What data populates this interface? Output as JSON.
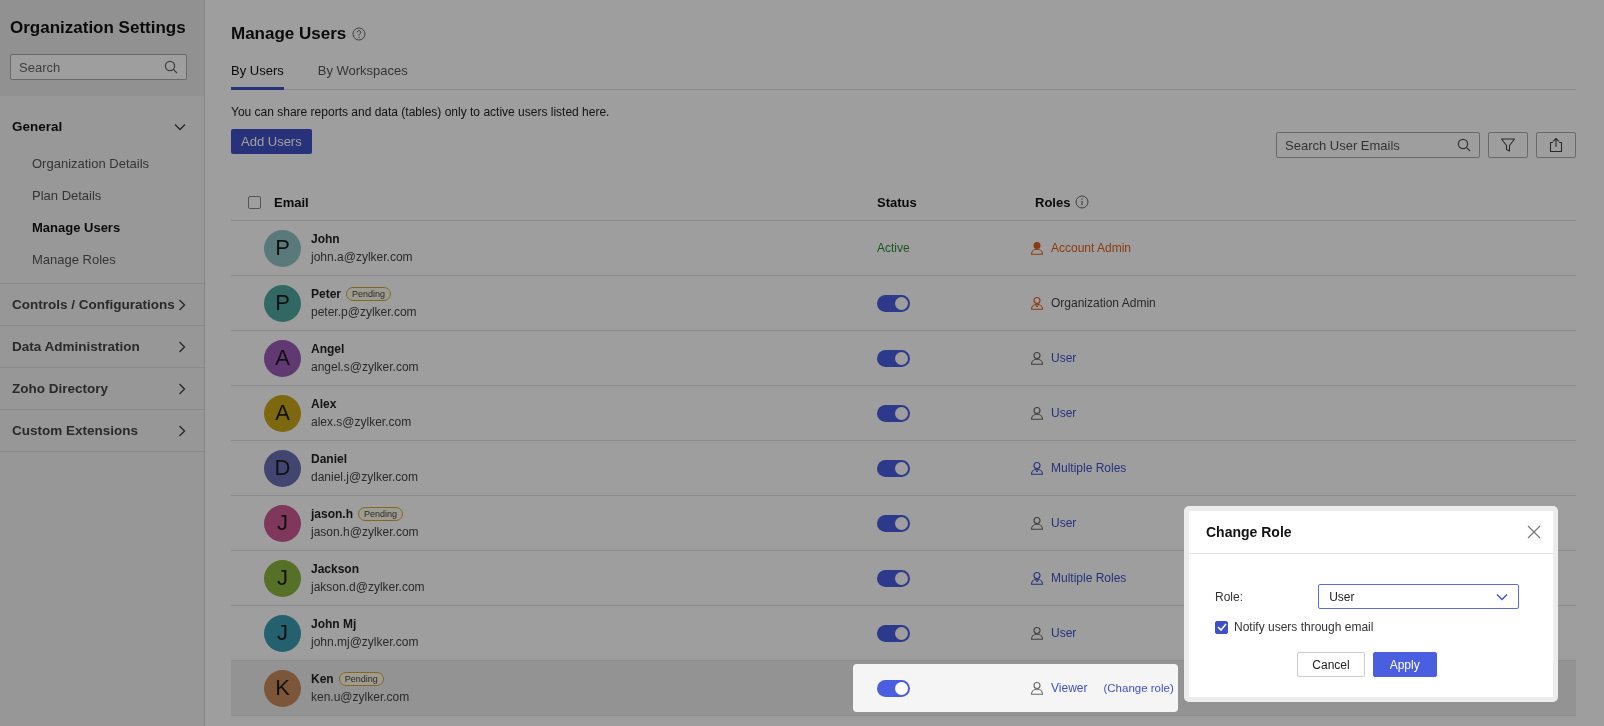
{
  "sidebar": {
    "title": "Organization Settings",
    "search": {
      "placeholder": "Search"
    },
    "sections": [
      {
        "label": "General",
        "expanded": true,
        "items": [
          {
            "label": "Organization Details",
            "selected": false
          },
          {
            "label": "Plan Details",
            "selected": false
          },
          {
            "label": "Manage Users",
            "selected": true
          },
          {
            "label": "Manage Roles",
            "selected": false
          }
        ]
      },
      {
        "label": "Controls / Configurations",
        "expanded": false
      },
      {
        "label": "Data Administration",
        "expanded": false
      },
      {
        "label": "Zoho Directory",
        "expanded": false
      },
      {
        "label": "Custom Extensions",
        "expanded": false
      }
    ]
  },
  "main": {
    "title": "Manage Users",
    "tabs": [
      {
        "label": "By Users",
        "selected": true
      },
      {
        "label": "By Workspaces",
        "selected": false
      }
    ],
    "info": "You can share reports and data (tables) only to active users listed here.",
    "add_button": "Add Users",
    "search": {
      "placeholder": "Search User Emails"
    },
    "table": {
      "select_all": {
        "checked": false
      },
      "columns": [
        "Email",
        "Status",
        "Roles"
      ],
      "rows": [
        {
          "initial": "P",
          "color": "#59797b",
          "name": "John",
          "pending": false,
          "email": "john.a@zylker.com",
          "status": {
            "kind": "text",
            "label": "Active"
          },
          "role": {
            "kind": "account-admin",
            "label": "Account Admin"
          },
          "highlighted": false
        },
        {
          "initial": "P",
          "color": "#316863",
          "name": "Peter",
          "pending": true,
          "pending_label": "Pending",
          "email": "peter.p@zylker.com",
          "status": {
            "kind": "toggle",
            "on": true
          },
          "role": {
            "kind": "org-admin",
            "label": "Organization Admin"
          },
          "highlighted": false
        },
        {
          "initial": "A",
          "color": "#603972",
          "name": "Angel",
          "pending": false,
          "email": "angel.s@zylker.com",
          "status": {
            "kind": "toggle",
            "on": true
          },
          "role": {
            "kind": "user",
            "label": "User"
          },
          "highlighted": false
        },
        {
          "initial": "A",
          "color": "#7d6810",
          "name": "Alex",
          "pending": false,
          "email": "alex.s@zylker.com",
          "status": {
            "kind": "toggle",
            "on": true
          },
          "role": {
            "kind": "user",
            "label": "User"
          },
          "highlighted": false
        },
        {
          "initial": "D",
          "color": "#424570",
          "name": "Daniel",
          "pending": false,
          "email": "daniel.j@zylker.com",
          "status": {
            "kind": "toggle",
            "on": true
          },
          "role": {
            "kind": "multiple",
            "label": "Multiple Roles"
          },
          "highlighted": false
        },
        {
          "initial": "J",
          "color": "#7f385c",
          "name": "jason.h",
          "pending": true,
          "pending_label": "Pending",
          "email": "jason.h@zylker.com",
          "status": {
            "kind": "toggle",
            "on": true
          },
          "role": {
            "kind": "user",
            "label": "User"
          },
          "highlighted": false
        },
        {
          "initial": "J",
          "color": "#567027",
          "name": "Jackson",
          "pending": false,
          "email": "jakson.d@zylker.com",
          "status": {
            "kind": "toggle",
            "on": true
          },
          "role": {
            "kind": "multiple",
            "label": "Multiple Roles"
          },
          "highlighted": false
        },
        {
          "initial": "J",
          "color": "#24606d",
          "name": "John Mj",
          "pending": false,
          "email": "john.mj@zylker.com",
          "status": {
            "kind": "toggle",
            "on": true
          },
          "role": {
            "kind": "user",
            "label": "User"
          },
          "highlighted": false
        },
        {
          "initial": "K",
          "color": "#7c5638",
          "name": "Ken",
          "pending": true,
          "pending_label": "Pending",
          "email": "ken.u@zylker.com",
          "status": {
            "kind": "toggle",
            "on": true
          },
          "role": {
            "kind": "user",
            "label": "Viewer"
          },
          "highlighted": true,
          "change_link": "(Change role)"
        }
      ]
    }
  },
  "dialog": {
    "title": "Change Role",
    "role_label": "Role:",
    "role_value": "User",
    "notify": {
      "label": "Notify users through email",
      "checked": true
    },
    "buttons": [
      "Cancel",
      "Apply"
    ]
  }
}
